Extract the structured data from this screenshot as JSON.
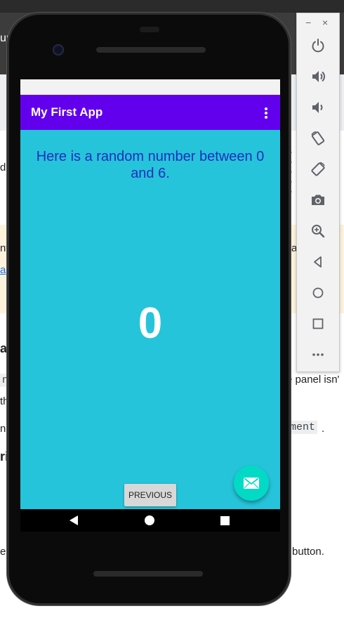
{
  "background_page": {
    "header_fragment": "ur",
    "fragments": [
      "d",
      "nf",
      "a",
      "av",
      "nt",
      "e panel isn'",
      "th",
      "na",
      "ment",
      ".",
      "ri",
      "e",
      "button.",
      "ra",
      "l"
    ]
  },
  "app": {
    "title": "My First App",
    "message": "Here is a random number between 0 and 6.",
    "number": "0",
    "previous_button": "PREVIOUS",
    "colors": {
      "app_bar": "#6200ee",
      "content_background": "#26c4da",
      "message_text": "#1f2fbf",
      "fab": "#03dac5"
    }
  },
  "fab_icon": "mail-icon",
  "nav_bar": {
    "icons": [
      "back-icon",
      "home-icon",
      "recents-icon"
    ]
  },
  "emulator_toolbar": {
    "window_controls": [
      "−",
      "×"
    ],
    "buttons": [
      "power-icon",
      "volume-up-icon",
      "volume-down-icon",
      "rotate-left-icon",
      "rotate-right-icon",
      "camera-icon",
      "zoom-icon",
      "back-icon",
      "home-icon",
      "overview-icon",
      "more-icon"
    ]
  }
}
